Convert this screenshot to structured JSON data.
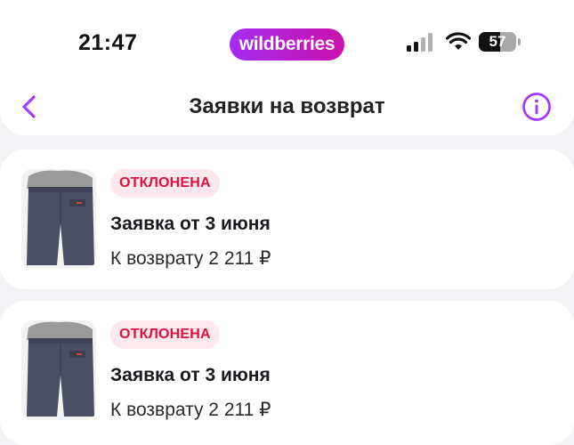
{
  "status_bar": {
    "time": "21:47",
    "brand": "wildberries",
    "battery": "57",
    "battery_level": 0.57
  },
  "header": {
    "title": "Заявки на возврат"
  },
  "requests": [
    {
      "status": "ОТКЛОНЕНА",
      "title": "Заявка от 3 июня",
      "amount": "К возврату 2 211 ₽"
    },
    {
      "status": "ОТКЛОНЕНА",
      "title": "Заявка от 3 июня",
      "amount": "К возврату 2 211 ₽"
    }
  ],
  "colors": {
    "accent": "#a73afd",
    "brand_gradient_start": "#a52cf0",
    "brand_gradient_end": "#cb11ab",
    "status_rejected_text": "#e0103f",
    "status_rejected_bg": "#fde8ee",
    "background": "#f3f3f6"
  },
  "icons": {
    "back": "chevron-left-icon",
    "info": "info-circle-icon",
    "signal": "cellular-signal-icon",
    "wifi": "wifi-icon",
    "battery": "battery-icon"
  }
}
